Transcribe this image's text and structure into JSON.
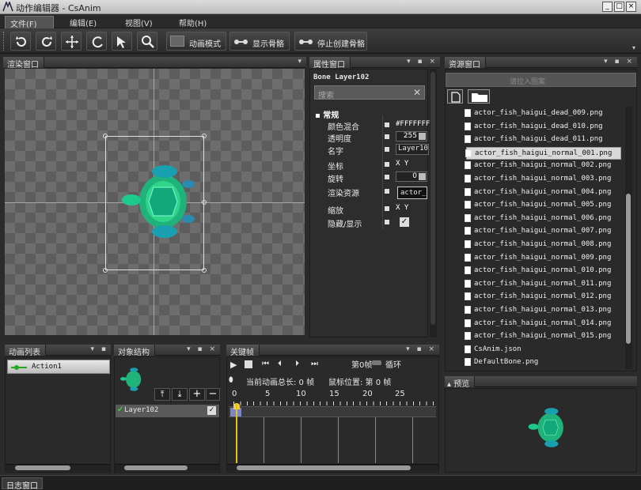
{
  "window": {
    "title": "动作编辑器 - CsAnim"
  },
  "window_controls": [
    "_",
    "□",
    "×"
  ],
  "menu": [
    "文件(F)",
    "编辑(E)",
    "视图(V)",
    "帮助(H)"
  ],
  "toolbar": {
    "anim_mode": "动画模式",
    "show_bone": "显示骨骼",
    "stop_create_bone": "停止创建骨骼"
  },
  "render_panel": {
    "title": "渲染窗口"
  },
  "props_panel": {
    "title": "属性窗口",
    "bone_label": "Bone Layer102",
    "search_placeholder": "搜索",
    "section": "常规",
    "rows": [
      {
        "key": "颜色混合",
        "value": "#FFFFFFF"
      },
      {
        "key": "透明度",
        "value": "255"
      },
      {
        "key": "名字",
        "value": "Layer10"
      },
      {
        "key": "坐标",
        "value": "X  Y"
      },
      {
        "key": "旋转",
        "value": "0"
      },
      {
        "key": "渲染资源",
        "value": "actor_"
      },
      {
        "key": "缩放",
        "value": "X  Y"
      },
      {
        "key": "隐藏/显示",
        "value": "✓"
      }
    ]
  },
  "res_panel": {
    "title": "资源窗口",
    "filter_placeholder": "请拉入图案",
    "files": [
      "actor_fish_haigui_dead_009.png",
      "actor_fish_haigui_dead_010.png",
      "actor_fish_haigui_dead_011.png",
      "actor_fish_haigui_normal_001.png",
      "actor_fish_haigui_normal_002.png",
      "actor_fish_haigui_normal_003.png",
      "actor_fish_haigui_normal_004.png",
      "actor_fish_haigui_normal_005.png",
      "actor_fish_haigui_normal_006.png",
      "actor_fish_haigui_normal_007.png",
      "actor_fish_haigui_normal_008.png",
      "actor_fish_haigui_normal_009.png",
      "actor_fish_haigui_normal_010.png",
      "actor_fish_haigui_normal_011.png",
      "actor_fish_haigui_normal_012.png",
      "actor_fish_haigui_normal_013.png",
      "actor_fish_haigui_normal_014.png",
      "actor_fish_haigui_normal_015.png",
      "CsAnim.json",
      "DefaultBone.png"
    ],
    "selected_index": 3
  },
  "preview_panel": {
    "title": "预览"
  },
  "anim_list_panel": {
    "title": "动画列表",
    "items": [
      "Action1"
    ]
  },
  "object_panel": {
    "title": "对象结构",
    "layer": "Layer102"
  },
  "keyframe_panel": {
    "title": "关键帧",
    "frame_label": "第0帧",
    "loop_label": "循环",
    "total_label": "当前动画总长: 0 帧",
    "mouse_label": "鼠标位置: 第 0 帧",
    "ticks": [
      "0",
      "5",
      "10",
      "15",
      "20",
      "25"
    ]
  },
  "status": {
    "log_tab": "日志窗口"
  },
  "colors": {
    "accent_green": "#2fd38a",
    "timeline_cursor": "#e8c020"
  },
  "icons": [
    "rotate-ccw-icon",
    "rotate-cw-icon",
    "move-icon",
    "rotate-icon",
    "select-arrow-icon",
    "zoom-icon",
    "bone-icon",
    "new-file-icon",
    "folder-icon"
  ]
}
